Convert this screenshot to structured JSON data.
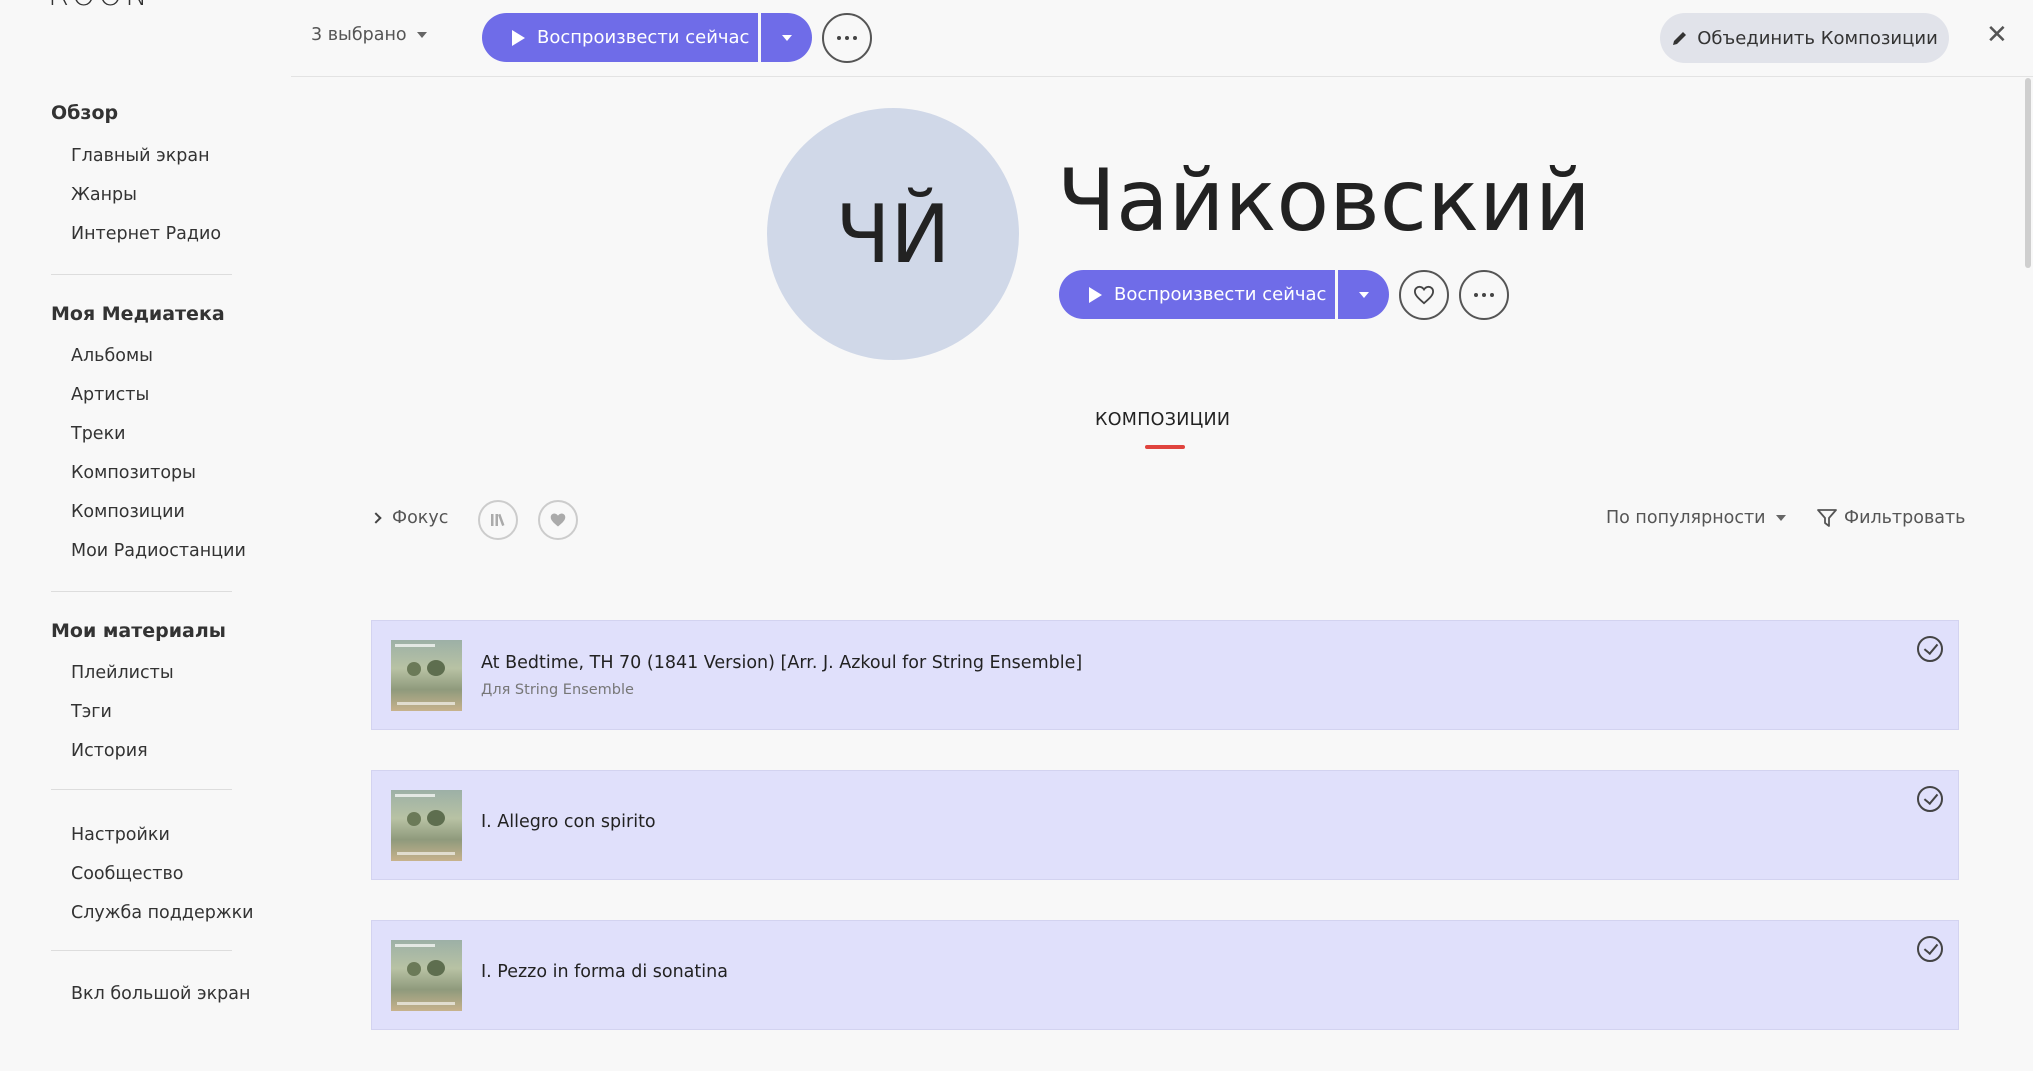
{
  "app": {
    "logo_text": "ROON"
  },
  "sidebar": {
    "overview_heading": "Обзор",
    "overview_items": [
      {
        "label": "Главный экран"
      },
      {
        "label": "Жанры"
      },
      {
        "label": "Интернет Радио"
      }
    ],
    "library_heading": "Моя Медиатека",
    "library_items": [
      {
        "label": "Альбомы"
      },
      {
        "label": "Артисты"
      },
      {
        "label": "Треки"
      },
      {
        "label": "Композиторы"
      },
      {
        "label": "Композиции"
      },
      {
        "label": "Мои Радиостанции"
      }
    ],
    "materials_heading": "Мои материалы",
    "materials_items": [
      {
        "label": "Плейлисты"
      },
      {
        "label": "Тэги"
      },
      {
        "label": "История"
      }
    ],
    "settings_items": [
      {
        "label": "Настройки"
      },
      {
        "label": "Сообщество"
      },
      {
        "label": "Служба поддержки"
      }
    ],
    "bigscreen_label": "Вкл большой экран"
  },
  "topbar": {
    "selected_count": "3 выбрано",
    "play_now_label": "Воспроизвести сейчас",
    "merge_label": "Объединить Композиции",
    "close_icon": "close-icon"
  },
  "hero": {
    "avatar_initials": "ЧЙ",
    "title": "Чайковский",
    "play_now_label": "Воспроизвести сейчас",
    "avatar_color": "#d0d8e8",
    "accent_color": "#6f6ce8"
  },
  "tabs": [
    {
      "label": "КОМПОЗИЦИИ",
      "active": true
    }
  ],
  "toolbar": {
    "focus_label": "Фокус",
    "sort_label": "По популярности",
    "filter_label": "Фильтровать"
  },
  "tracks": [
    {
      "title": "At Bedtime, TH 70 (1841 Version) [Arr. J. Azkoul for String Ensemble]",
      "subtitle": "Для String Ensemble",
      "selected": true
    },
    {
      "title": "I. Allegro con spirito",
      "subtitle": "",
      "selected": true
    },
    {
      "title": "I. Pezzo in forma di sonatina",
      "subtitle": "",
      "selected": true
    }
  ]
}
